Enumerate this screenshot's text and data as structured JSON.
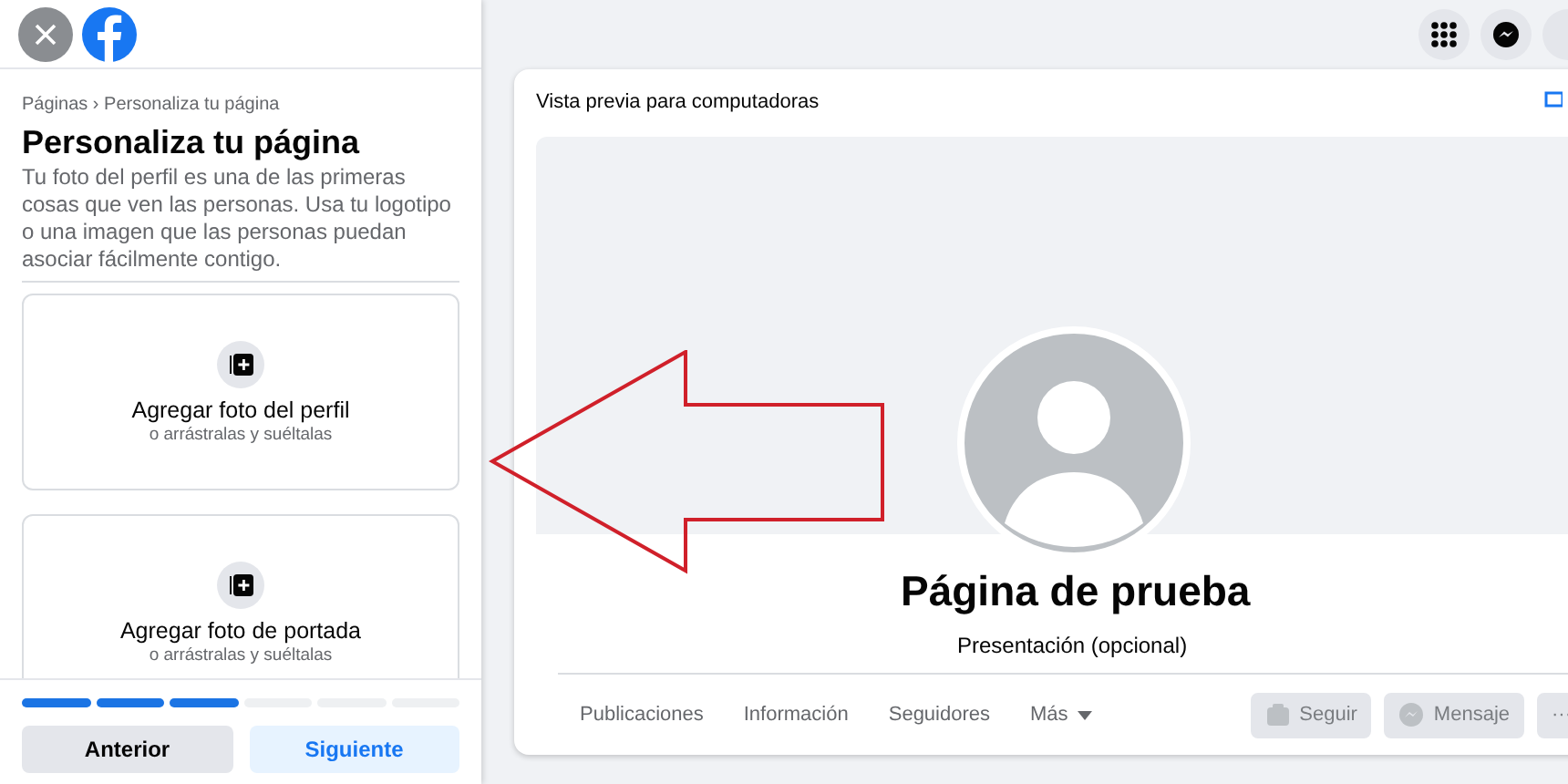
{
  "sidebar": {
    "breadcrumb": "Páginas › Personaliza tu página",
    "title": "Personaliza tu página",
    "description": "Tu foto del perfil es una de las primeras cosas que ven las personas. Usa tu logotipo o una imagen que las personas puedan asociar fácilmente contigo.",
    "upload_cards": [
      {
        "title": "Agregar foto del perfil",
        "hint": "o arrástralas y suéltalas"
      },
      {
        "title": "Agregar foto de portada",
        "hint": "o arrástralas y suéltalas"
      }
    ],
    "steps": [
      {
        "done": true
      },
      {
        "done": true
      },
      {
        "done": true
      },
      {
        "done": false
      },
      {
        "done": false
      },
      {
        "done": false
      }
    ],
    "buttons": [
      {
        "label": "Anterior",
        "kind": "secondary"
      },
      {
        "label": "Siguiente",
        "kind": "primary"
      }
    ]
  },
  "preview": {
    "title": "Vista previa para computadoras",
    "page_name": "Página de prueba",
    "subtitle": "Presentación (opcional)",
    "tabs": [
      {
        "label": "Publicaciones",
        "kind": "plain"
      },
      {
        "label": "Información",
        "kind": "plain"
      },
      {
        "label": "Seguidores",
        "kind": "plain"
      },
      {
        "label": "Más",
        "kind": "dropdown"
      }
    ],
    "actions": [
      {
        "label": "Seguir",
        "kind": "follow",
        "disabled": true
      },
      {
        "label": "Mensaje",
        "kind": "message",
        "disabled": true
      },
      {
        "label": "···",
        "kind": "more",
        "disabled": true
      }
    ]
  }
}
